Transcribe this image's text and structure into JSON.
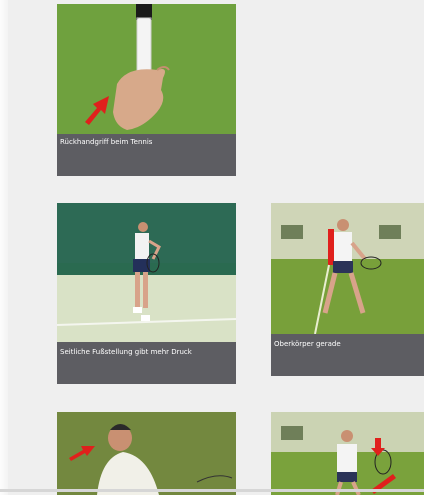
{
  "gallery": {
    "items": [
      {
        "caption": "Rückhandgriff beim Tennis",
        "image": "tennis-grip-hand-photo"
      },
      {
        "caption": "Seitliche Fußstellung gibt mehr Druck",
        "image": "tennis-side-stance-photo"
      },
      {
        "caption": "Oberkörper gerade",
        "image": "tennis-upright-body-photo"
      },
      {
        "caption": "",
        "image": "tennis-player-portrait-photo"
      },
      {
        "caption": "",
        "image": "tennis-player-arrow-photo"
      }
    ]
  },
  "colors": {
    "background": "#efefef",
    "caption_bar": "#5d5d62",
    "grass": "#6a9c3a",
    "arrow": "#e0201c"
  }
}
